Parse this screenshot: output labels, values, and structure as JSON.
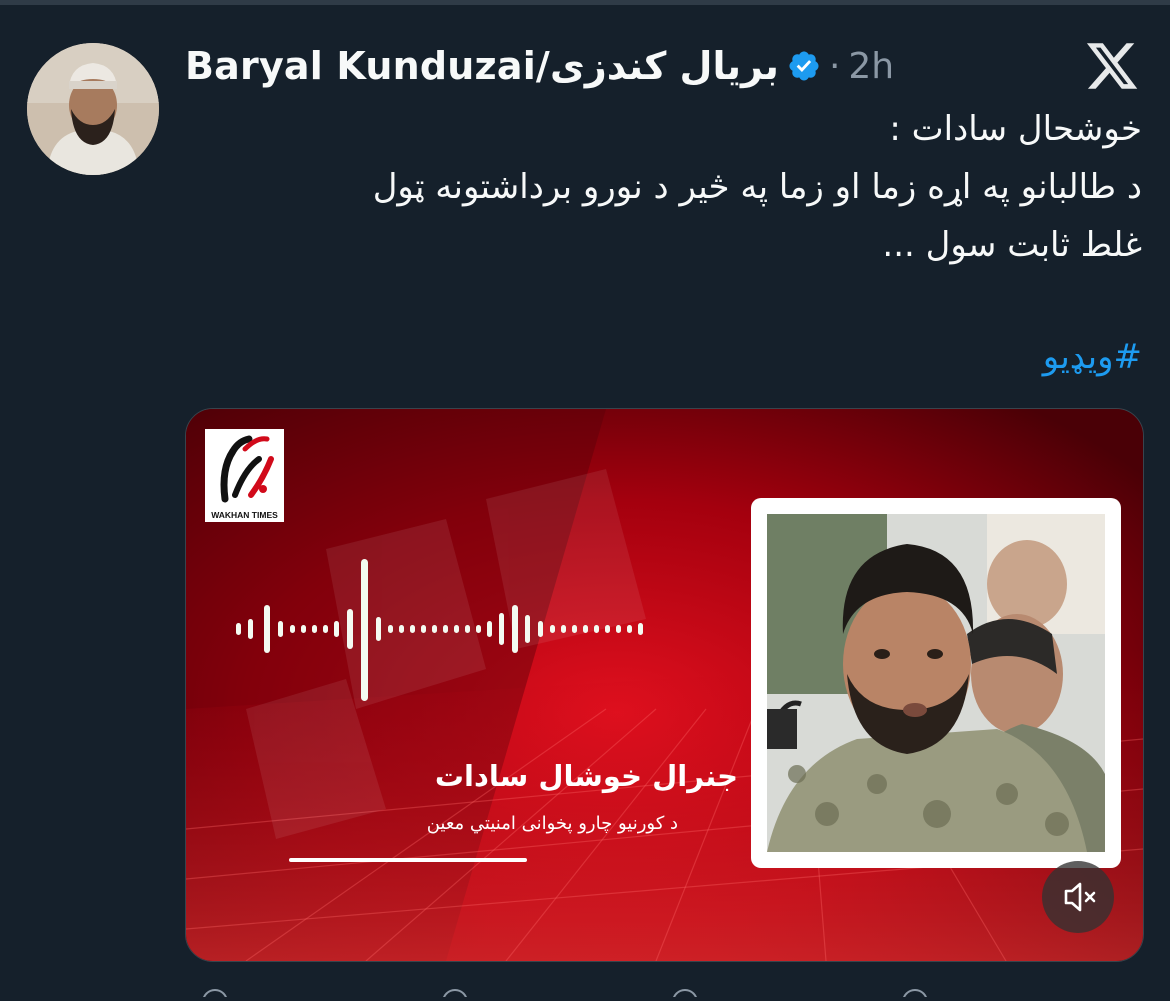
{
  "tweet": {
    "author_name": "Baryal Kunduzai/بریال کندزی",
    "separator": "·",
    "time": "2h",
    "text_lines": [
      "خوشحال سادات :",
      "د طالبانو په اړه زما او زما په څیر د نورو برداشتونه ټول",
      "غلط ثابت سول ..."
    ],
    "hashtag": "#ویډیو"
  },
  "media": {
    "logo_caption": "WAKHAN TIMES",
    "caption_title": "جنرال خوشال سادات",
    "caption_subtitle": "د کورنیو چارو پخوانی امنیتي معین",
    "muted": true
  },
  "colors": {
    "background": "#15202b",
    "accent": "#1d9bf0",
    "media_red": "#d10a1a"
  },
  "icons": [
    "verified-badge-icon",
    "x-logo-icon",
    "volume-muted-icon"
  ]
}
